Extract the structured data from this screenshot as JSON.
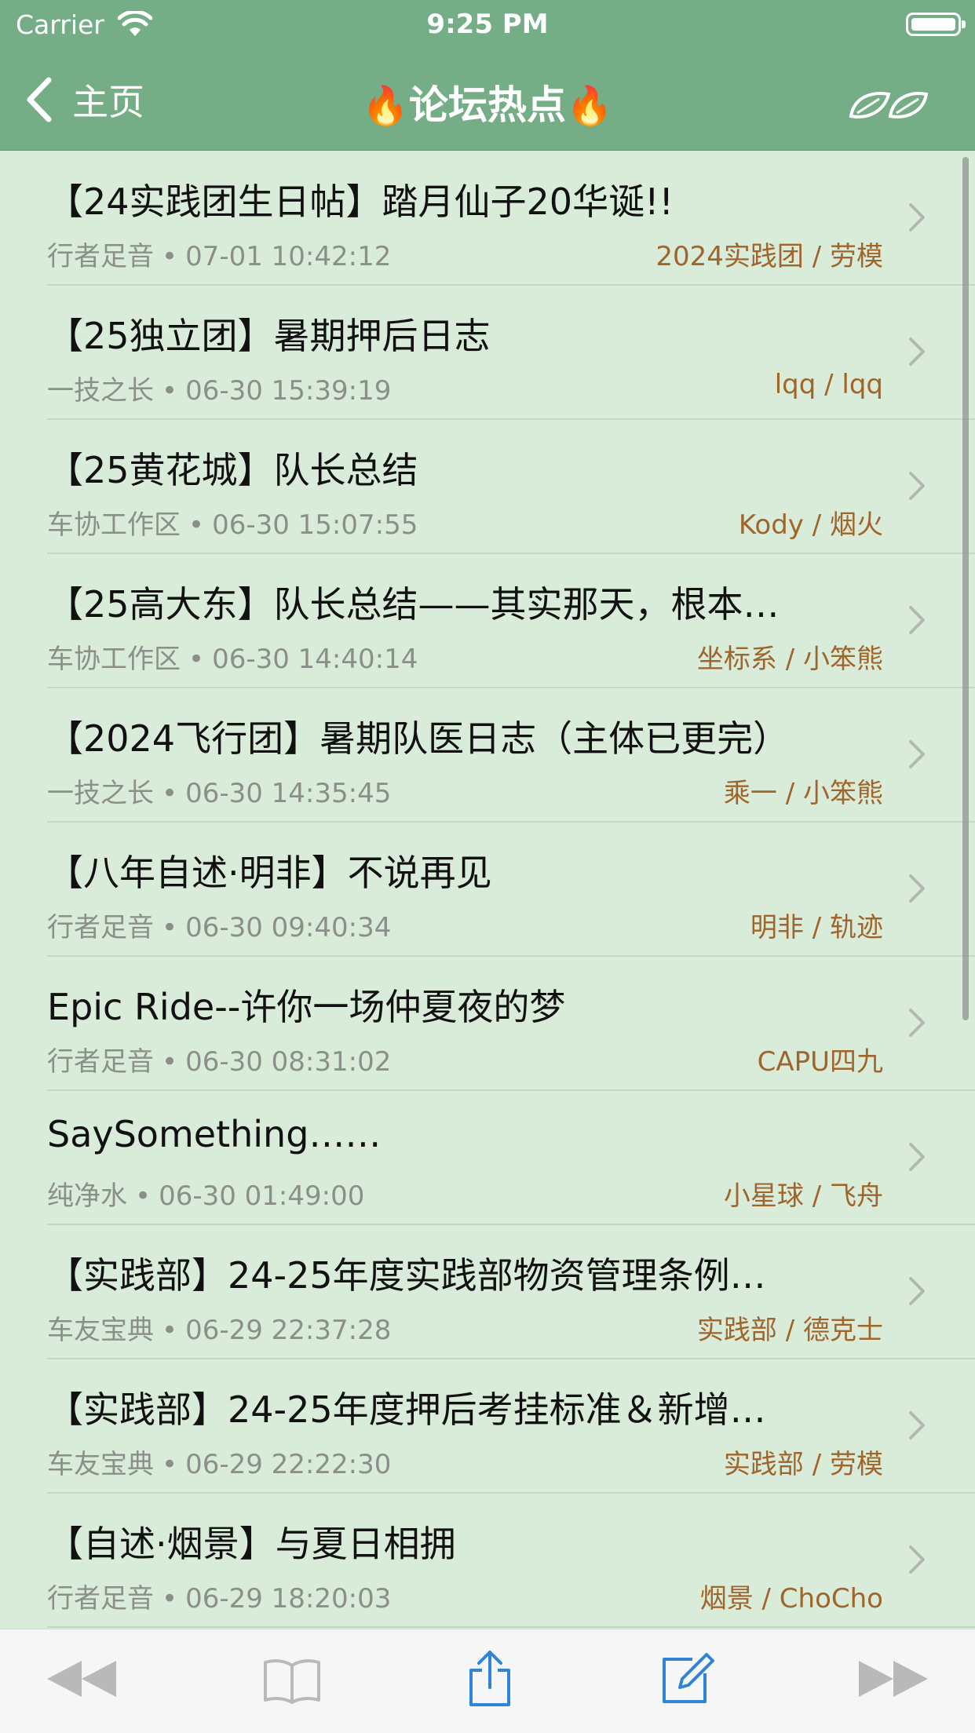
{
  "status_bar": {
    "carrier": "Carrier",
    "time": "9:25 PM"
  },
  "nav": {
    "back_label": "主页",
    "title": "论坛热点",
    "title_emoji": "🔥"
  },
  "colors": {
    "nav_background": "#74ad86",
    "list_background": "#d9ebd9",
    "author_text": "#a0652a",
    "meta_text": "#8a8f8a",
    "toolbar_active": "#2f84d8",
    "toolbar_inactive": "#b9b9b9"
  },
  "icons": {
    "back": "chevron-left-icon",
    "nav_right": "leaves-icon",
    "row_disclosure": "chevron-right-icon",
    "toolbar": [
      "rewind-icon",
      "book-icon",
      "share-icon",
      "compose-icon",
      "fast-forward-icon"
    ]
  },
  "items": [
    {
      "title": "【24实践团生日帖】踏月仙子20华诞!!",
      "board": "行者足音",
      "time": "07-01 10:42:12",
      "author": "2024实践团 / 劳模"
    },
    {
      "title": "【25独立团】暑期押后日志",
      "board": "一技之长",
      "time": "06-30 15:39:19",
      "author": "lqq / lqq"
    },
    {
      "title": "【25黄花城】队长总结",
      "board": "车协工作区",
      "time": "06-30 15:07:55",
      "author": "Kody / 烟火"
    },
    {
      "title": "【25高大东】队长总结——其实那天，根本…",
      "board": "车协工作区",
      "time": "06-30 14:40:14",
      "author": "坐标系 / 小笨熊"
    },
    {
      "title": "【2024飞行团】暑期队医日志（主体已更完）",
      "board": "一技之长",
      "time": "06-30 14:35:45",
      "author": "乘一 / 小笨熊"
    },
    {
      "title": "【八年自述·明非】不说再见",
      "board": "行者足音",
      "time": "06-30 09:40:34",
      "author": "明非 / 轨迹"
    },
    {
      "title": "Epic Ride--许你一场仲夏夜的梦",
      "board": "行者足音",
      "time": "06-30 08:31:02",
      "author": "CAPU四九"
    },
    {
      "title": "SaySomething……",
      "board": "纯净水",
      "time": "06-30 01:49:00",
      "author": "小星球 / 飞舟"
    },
    {
      "title": "【实践部】24-25年度实践部物资管理条例…",
      "board": "车友宝典",
      "time": "06-29 22:37:28",
      "author": "实践部 / 德克士"
    },
    {
      "title": "【实践部】24-25年度押后考挂标准＆新增…",
      "board": "车友宝典",
      "time": "06-29 22:22:30",
      "author": "实践部 / 劳模"
    },
    {
      "title": "【自述·烟景】与夏日相拥",
      "board": "行者足音",
      "time": "06-29 18:20:03",
      "author": "烟景 / ChoCho"
    }
  ]
}
